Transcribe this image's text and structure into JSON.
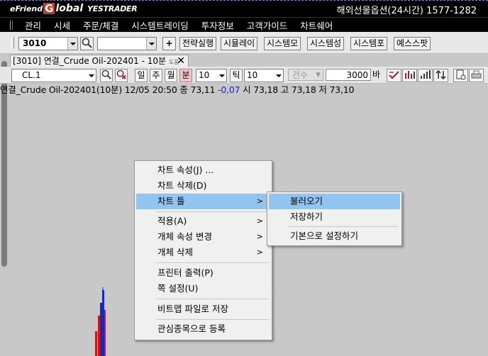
{
  "app": {
    "brand_prefix": "eFriend",
    "brand_g": "G",
    "brand_main": "lobal",
    "brand_product": "YESTRADER",
    "phone": "해외선물옵션(24시간) 1577-1282"
  },
  "menubar": [
    "관리",
    "시세",
    "주문/체결",
    "시스템트레이딩",
    "투자정보",
    "고객가이드",
    "차트쉐어"
  ],
  "toolbar": {
    "code": "3010",
    "plus": "+",
    "buttons": [
      "전략실행",
      "시뮬레이",
      "시스템모",
      "시스템성",
      "시스템포",
      "예스스팟"
    ]
  },
  "window_tab": {
    "label": "[3010] 연결_Crude Oil-202401 - 10분",
    "small": "도움"
  },
  "chart_toolbar": {
    "symbol": "CL.1",
    "periods": [
      "일",
      "주",
      "월",
      "분"
    ],
    "interval": "10",
    "tick_label": "틱",
    "tick_value": "10",
    "count_label": "건수",
    "bars_value": "3000",
    "bars_unit": "바"
  },
  "infoline": {
    "prefix": "연결_Crude Oil-202401(10분) 12/05 20:50  종 73,11 ",
    "change": "-0,07",
    "suffix": "  시 73,18 고 73,18 저 73,10"
  },
  "context_menu": {
    "items": [
      "차트 속성(J) ...",
      "차트 삭제(D)",
      "차트 틀",
      "적용(A)",
      "개체 속성 변경",
      "개체 삭제",
      "프린터 출력(P)",
      "쪽 설정(U)",
      "비트맵 파일로 저장",
      "관심종목으로 등록"
    ],
    "submenu_arrow": ">"
  },
  "submenu": {
    "items": [
      "불러오기",
      "저장하기",
      "기본으로 설정하기"
    ]
  },
  "colors": {
    "highlight": "#92c4f0",
    "candle_up": "#d21414",
    "candle_down": "#1428c8",
    "change_negative": "#1e1ed2"
  }
}
